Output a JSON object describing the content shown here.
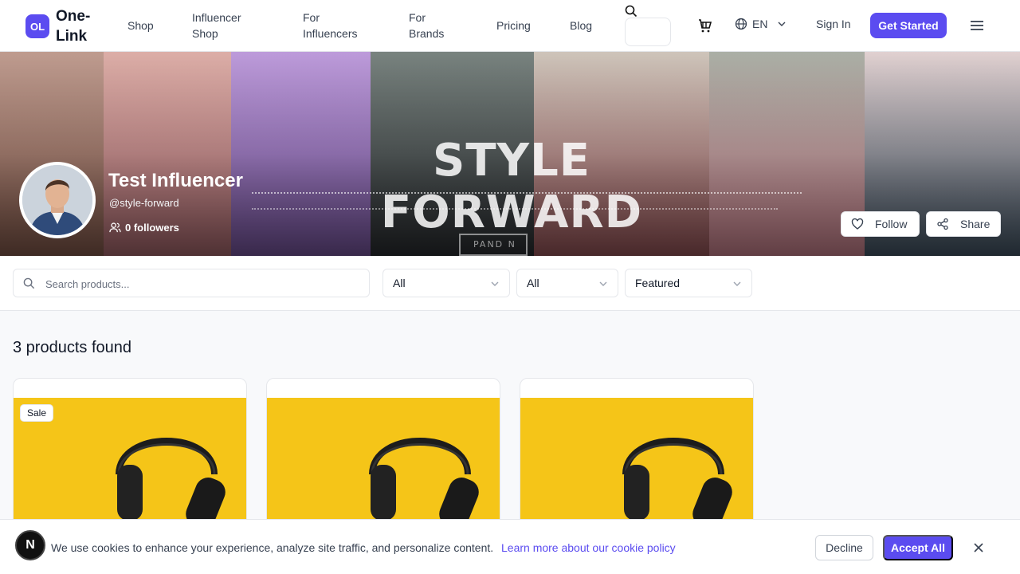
{
  "nav": {
    "logo_badge": "OL",
    "logo_text": "One-Link",
    "links": [
      "Shop",
      "Influencer Shop",
      "For Influencers",
      "For Brands",
      "Pricing",
      "Blog"
    ],
    "language": "EN",
    "sign_in": "Sign In",
    "get_started": "Get Started",
    "icons": [
      "search-icon",
      "cart-icon",
      "globe-icon",
      "chevron-down-icon",
      "menu-icon"
    ]
  },
  "banner": {
    "headline": "STYLE FORWARD",
    "tag": "PAND N"
  },
  "influencer": {
    "name": "Test Influencer",
    "handle": "@style-forward",
    "followers": "0 followers",
    "follow_label": "Follow",
    "share_label": "Share"
  },
  "filters": {
    "search_placeholder": "Search products...",
    "category": "All",
    "price": "All",
    "sort": "Featured"
  },
  "results": {
    "count_label": "3 products found",
    "products": [
      {
        "badge": "Sale",
        "image": "headphones-on-yellow"
      },
      {
        "badge": "",
        "image": "headphones-on-yellow"
      },
      {
        "badge": "",
        "image": "headphones-on-yellow"
      }
    ]
  },
  "cookie": {
    "badge": "N",
    "text": "We use cookies to enhance your experience, analyze site traffic, and personalize content.",
    "link": "Learn more about our cookie policy",
    "decline": "Decline",
    "accept": "Accept All"
  },
  "colors": {
    "accent": "#5b4cf0",
    "product_bg": "#f5c518"
  }
}
